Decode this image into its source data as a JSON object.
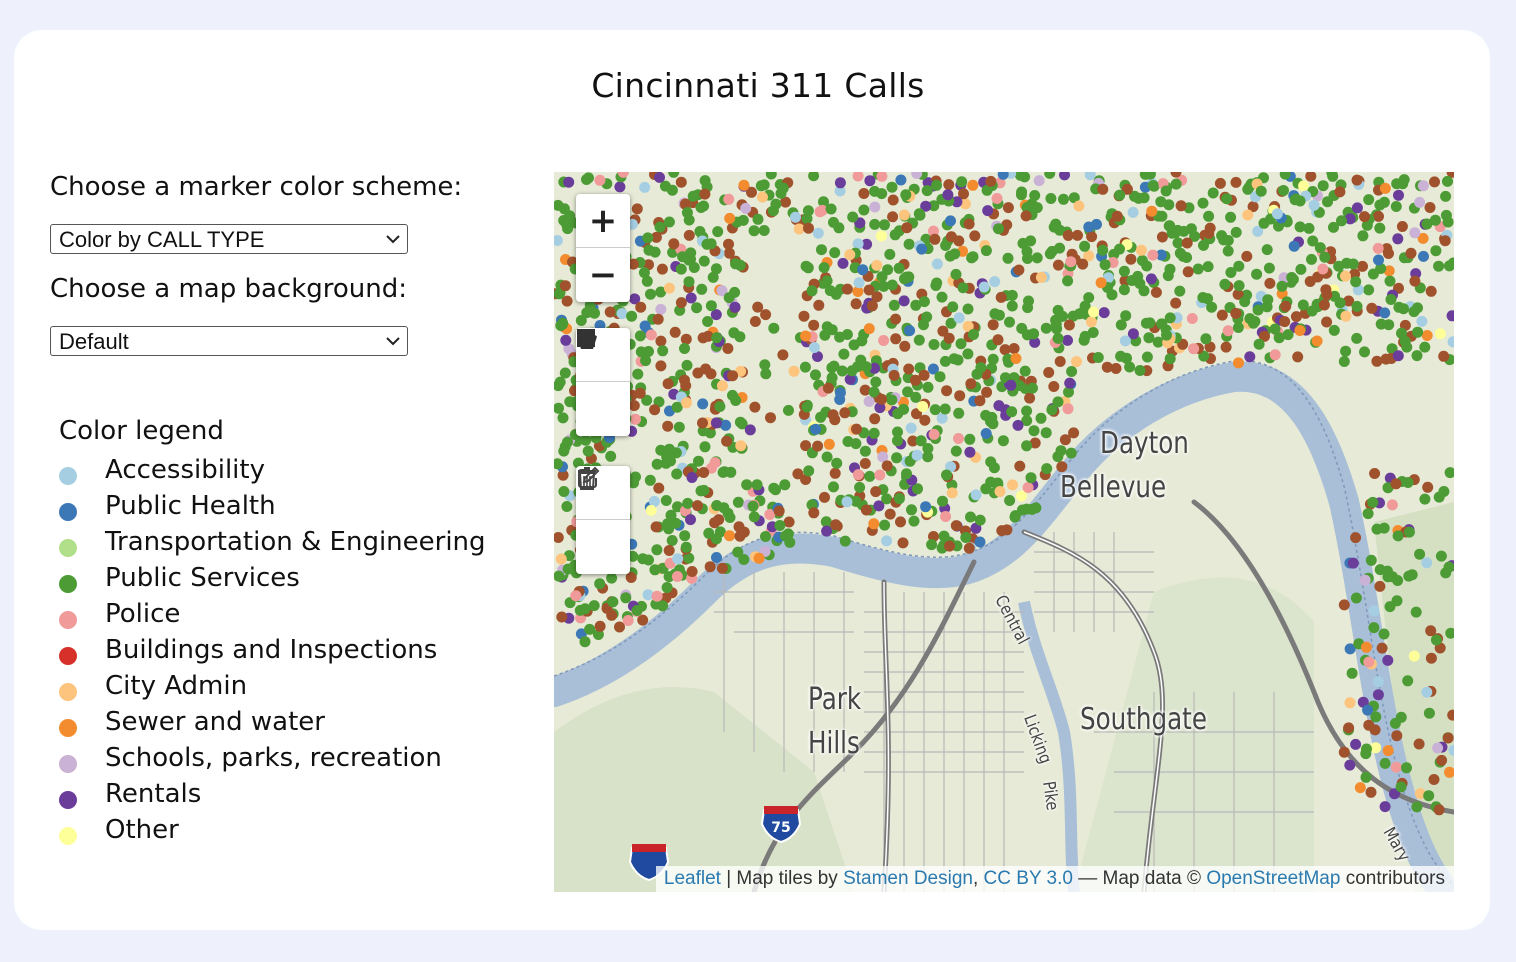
{
  "page_title": "Cincinnati 311 Calls",
  "controls": {
    "color_scheme_label": "Choose a marker color scheme:",
    "color_scheme_value": "Color by CALL TYPE",
    "background_label": "Choose a map background:",
    "background_value": "Default"
  },
  "legend": {
    "title": "Color legend",
    "items": [
      {
        "label": "Accessibility",
        "color": "#a6cee3"
      },
      {
        "label": "Public Health",
        "color": "#3b78b5"
      },
      {
        "label": "Transportation & Engineering",
        "color": "#b2df8a"
      },
      {
        "label": "Public Services",
        "color": "#4c9b35"
      },
      {
        "label": "Police",
        "color": "#f09a9a"
      },
      {
        "label": "Buildings and Inspections",
        "color": "#d7302b"
      },
      {
        "label": "City Admin",
        "color": "#fdc47d"
      },
      {
        "label": "Sewer and water",
        "color": "#f28c2e"
      },
      {
        "label": "Schools, parks, recreation",
        "color": "#cab2d6"
      },
      {
        "label": "Rentals",
        "color": "#6a3d9a"
      },
      {
        "label": "Other",
        "color": "#ffff99"
      }
    ]
  },
  "map": {
    "zoom_in": "+",
    "zoom_out": "−",
    "tools": [
      "polygon-tool",
      "rectangle-tool",
      "edit-tool",
      "delete-tool"
    ],
    "places": [
      "Dayton",
      "Bellevue",
      "Park",
      "Hills",
      "Southgate",
      "Central",
      "Licking",
      "Pike",
      "75",
      "Mary"
    ],
    "attribution": {
      "leaflet": "Leaflet",
      "sep1": " | Map tiles by ",
      "stamen": "Stamen Design",
      "comma": ", ",
      "license": "CC BY 3.0",
      "sep2": " — Map data © ",
      "osm": "OpenStreetMap",
      "tail": " contributors"
    }
  }
}
